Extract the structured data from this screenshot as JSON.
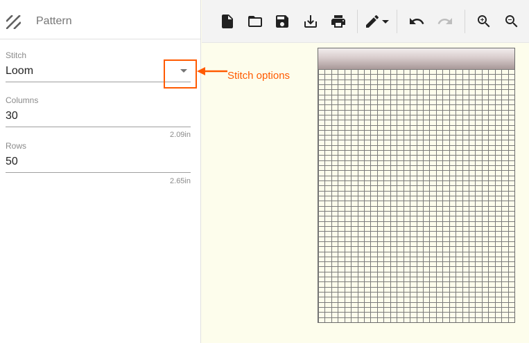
{
  "sidebar": {
    "title": "Pattern",
    "stitch": {
      "label": "Stitch",
      "value": "Loom"
    },
    "columns": {
      "label": "Columns",
      "value": "30",
      "hint": "2.09in"
    },
    "rows": {
      "label": "Rows",
      "value": "50",
      "hint": "2.65in"
    }
  },
  "annotation": {
    "text": "Stitch options",
    "color": "#ff5a00"
  },
  "toolbar": {
    "buttons": [
      "new-file-icon",
      "open-folder-icon",
      "save-icon",
      "download-icon",
      "print-icon",
      "pencil-icon",
      "undo-icon",
      "redo-icon",
      "zoom-in-icon",
      "zoom-out-icon"
    ]
  },
  "pattern": {
    "columns": 30,
    "rows": 50,
    "background": "#fdfdec",
    "grid_color": "#7a7a7a"
  }
}
